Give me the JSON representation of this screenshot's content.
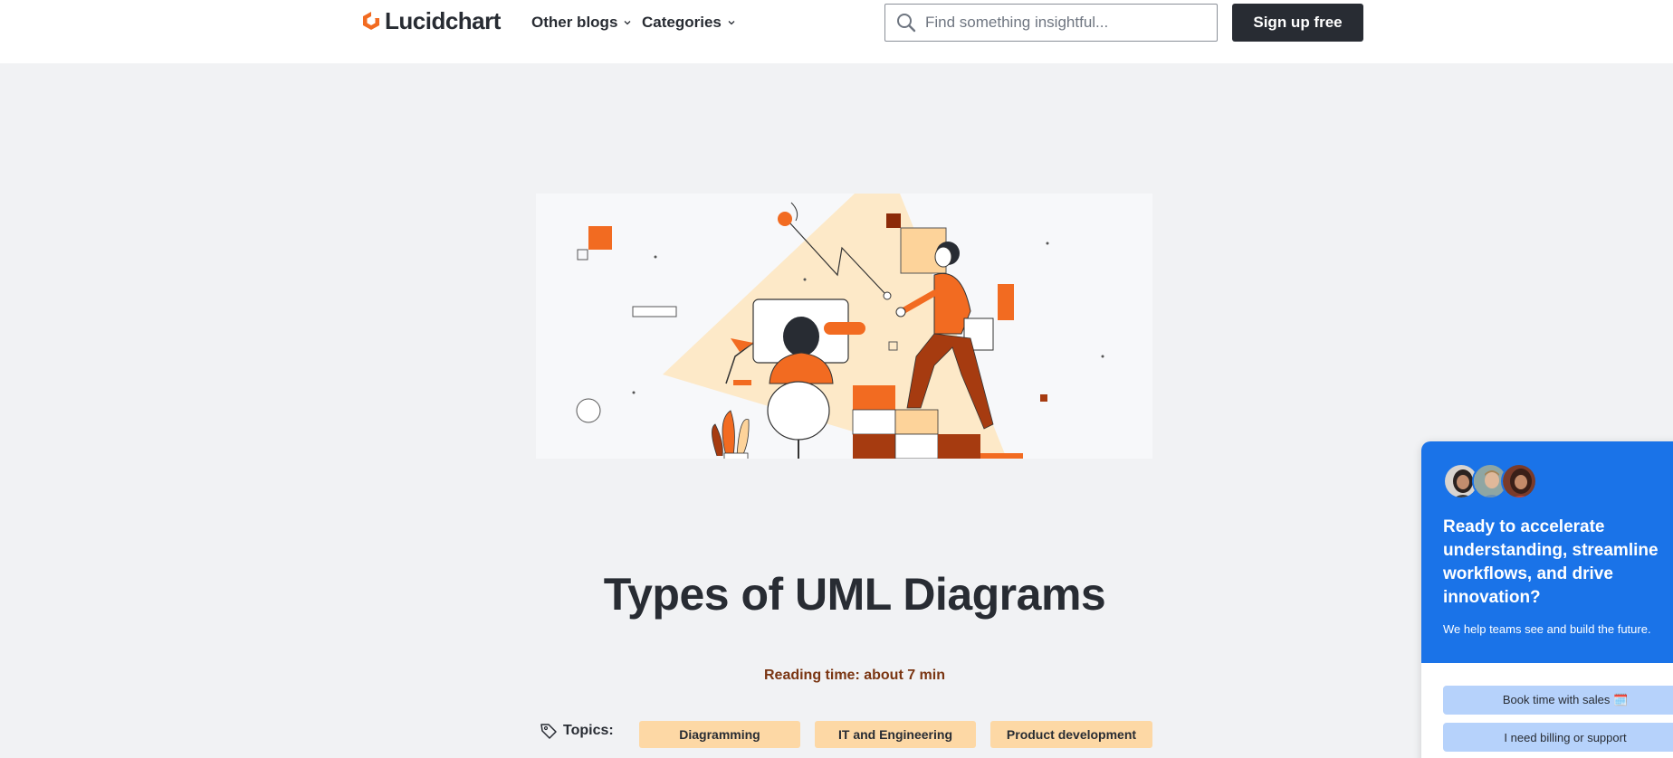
{
  "header": {
    "logo_text": "Lucidchart",
    "nav": [
      {
        "label": "Other blogs"
      },
      {
        "label": "Categories"
      }
    ],
    "search_placeholder": "Find something insightful...",
    "signup_label": "Sign up free"
  },
  "article": {
    "title": "Types of UML Diagrams",
    "reading_time": "Reading time: about 7 min",
    "topics_label": "Topics:",
    "topics": [
      "Diagramming",
      "IT and Engineering",
      "Product development"
    ]
  },
  "chat_widget": {
    "title_lines": [
      "Ready to accelerate",
      "understanding, streamline",
      "workflows, and drive",
      "innovation?"
    ],
    "subtitle": "We help teams see and build the future.",
    "buttons": [
      "Book time with sales 🗓️",
      "I need billing or support"
    ]
  },
  "colors": {
    "brand_orange": "#f26b21",
    "dark": "#282c33",
    "topic_pill": "#fdd8a5",
    "chat_blue": "#1a73e8",
    "chat_button": "#b6d2fb"
  }
}
